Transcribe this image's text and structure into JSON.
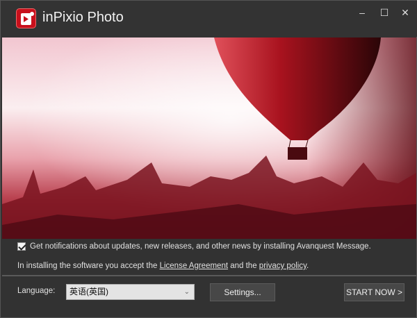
{
  "window": {
    "title": "inPixio Photo",
    "controls": {
      "minimize": "–",
      "maximize": "☐",
      "close": "✕"
    }
  },
  "notifications": {
    "checked": true,
    "label": "Get notifications about updates, new releases, and other news by installing Avanquest Message."
  },
  "legal": {
    "prefix": "In installing the software you accept the ",
    "license_link": "License Agreement",
    "middle": " and the ",
    "privacy_link": "privacy policy",
    "suffix": "."
  },
  "footer": {
    "language_label": "Language:",
    "language_value": "英语(英国)",
    "settings_label": "Settings...",
    "start_label": "START NOW >"
  },
  "colors": {
    "brand": "#c8101c",
    "background": "#333333"
  }
}
